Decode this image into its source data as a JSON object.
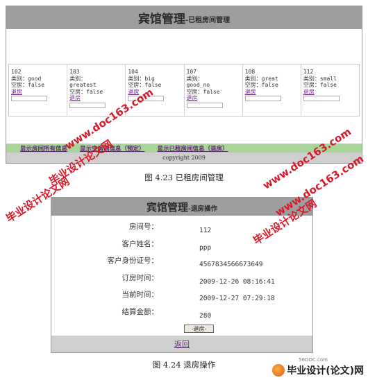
{
  "figure1": {
    "title_big": "宾馆管理",
    "title_small": "-已租房间管理",
    "rooms": [
      {
        "number": "102",
        "type_line": "类别：good",
        "type_line2": "",
        "empty_line": "空房：false",
        "checkout": "退房"
      },
      {
        "number": "103",
        "type_line": "类别：",
        "type_line2": "greatest",
        "empty_line": "空房：false",
        "checkout": "退房"
      },
      {
        "number": "104",
        "type_line": "类别：big",
        "type_line2": "",
        "empty_line": "空房：false",
        "checkout": "退房"
      },
      {
        "number": "107",
        "type_line": "类别：",
        "type_line2": "good_no",
        "empty_line": "空房：false",
        "checkout": "退房"
      },
      {
        "number": "108",
        "type_line": "类别：great",
        "type_line2": "",
        "empty_line": "空房：false",
        "checkout": "退房"
      },
      {
        "number": "112",
        "type_line": "类别：small",
        "type_line2": "",
        "empty_line": "空房：false",
        "checkout": "退房"
      }
    ],
    "nav": [
      "显示房间所有信息",
      "显示空房间信息（预定）",
      "显示已租房间信息（退房）"
    ],
    "footer": "copyright 2009"
  },
  "caption1": "图 4.23  已租房间管理",
  "figure2": {
    "title_big": "宾馆管理",
    "title_small": "-退房操作",
    "rows": [
      {
        "label": "房间号：",
        "value": "112"
      },
      {
        "label": "客户姓名：",
        "value": "ppp"
      },
      {
        "label": "客户身份证号：",
        "value": "4567834566673649"
      },
      {
        "label": "订房时间：",
        "value": "2009-12-26 08:16:41"
      },
      {
        "label": "当前时间：",
        "value": "2009-12-27 07:29:18"
      },
      {
        "label": "结算金额：",
        "value": "280"
      }
    ],
    "submit": "-退房-",
    "back": "返回"
  },
  "caption2": "图 4.24  退房操作",
  "watermark": {
    "cn": "毕业设计论文网",
    "url": "www.doc163.com"
  },
  "logo": {
    "text": "毕业设计(论文)网",
    "site": "56DOC.com"
  }
}
